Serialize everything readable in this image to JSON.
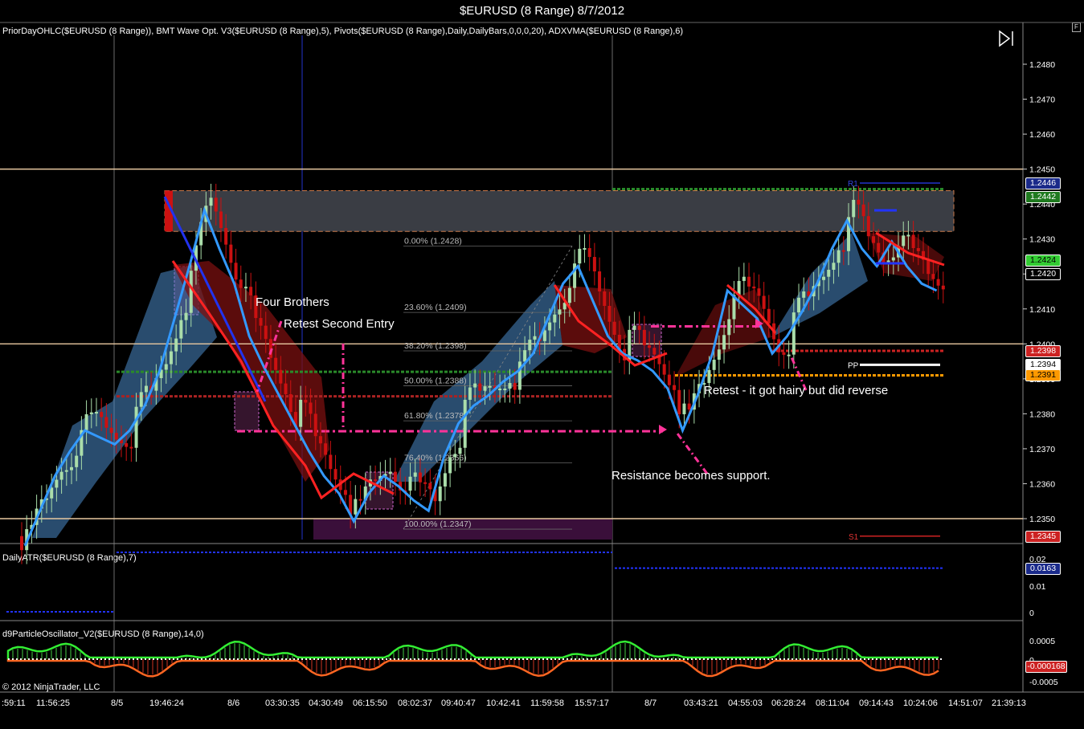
{
  "window": {
    "title": "$EURUSD (8 Range)  8/7/2012",
    "float_button": "F"
  },
  "panels": {
    "price": {
      "indicator_label": "PriorDayOHLC($EURUSD (8 Range)), BMT Wave Opt. V3($EURUSD (8 Range),5), Pivots($EURUSD (8 Range),Daily,DailyBars,0,0,0,20), ADXVMA($EURUSD (8 Range),6)"
    },
    "atr": {
      "indicator_label": "DailyATR($EURUSD (8 Range),7)"
    },
    "oscillator": {
      "indicator_label": "d9ParticleOscillator_V2($EURUSD (8 Range),14,0)"
    }
  },
  "copyright": "© 2012 NinjaTrader, LLC",
  "price_axis": {
    "ticks": [
      "1.2480",
      "1.2470",
      "1.2460",
      "1.2450",
      "1.2440",
      "1.2430",
      "1.2420",
      "1.2410",
      "1.2400",
      "1.2390",
      "1.2380",
      "1.2370",
      "1.2360",
      "1.2350"
    ]
  },
  "price_markers": [
    {
      "label": "1.2446",
      "bg": "#1a2a8a",
      "fg": "#ffffff",
      "value": 1.2446
    },
    {
      "label": "1.2442",
      "bg": "#1f7a1f",
      "fg": "#ffffff",
      "value": 1.2442
    },
    {
      "label": "1.2424",
      "bg": "#33cc33",
      "fg": "#000000",
      "value": 1.2424
    },
    {
      "label": "1.2420",
      "bg": "#000000",
      "fg": "#ffffff",
      "value": 1.242
    },
    {
      "label": "1.2398",
      "bg": "#cc2222",
      "fg": "#ffffff",
      "value": 1.2398
    },
    {
      "label": "1.2394",
      "bg": "#ffffff",
      "fg": "#000000",
      "value": 1.2394
    },
    {
      "label": "1.2391",
      "bg": "#ff9900",
      "fg": "#000000",
      "value": 1.2391
    },
    {
      "label": "1.2345",
      "bg": "#cc2222",
      "fg": "#ffffff",
      "value": 1.2345
    }
  ],
  "pivot_labels": {
    "r1": "R1",
    "pp": "PP",
    "s1": "S1"
  },
  "fib_levels": [
    {
      "label": "0.00% (1.2428)",
      "value": 1.2428
    },
    {
      "label": "23.60% (1.2409)",
      "value": 1.2409
    },
    {
      "label": "38.20% (1.2398)",
      "value": 1.2398
    },
    {
      "label": "50.00% (1.2388)",
      "value": 1.2388
    },
    {
      "label": "61.80% (1.2378)",
      "value": 1.2378
    },
    {
      "label": "76.40% (1.2366)",
      "value": 1.2366
    },
    {
      "label": "100.00% (1.2347)",
      "value": 1.2347
    }
  ],
  "annotations": {
    "four_brothers": "Four Brothers",
    "retest_second": "Retest Second Entry",
    "retest_hairy": "Retest - it got hairy but did reverse",
    "resistance_support": "Resistance becomes support."
  },
  "atr_axis": {
    "ticks": [
      "0.02",
      "0.01",
      "0"
    ],
    "marker": "0.0163"
  },
  "osc_axis": {
    "ticks": [
      "0.0005",
      "0",
      "-0.0005"
    ],
    "marker": "-0.000168"
  },
  "time_axis": {
    "labels": [
      ":59:11",
      "11:56:25",
      "8/5",
      "19:46:24",
      "8/6",
      "03:30:35",
      "04:30:49",
      "06:15:50",
      "08:02:37",
      "09:40:47",
      "10:42:41",
      "11:59:58",
      "15:57:17",
      "8/7",
      "03:43:21",
      "04:55:03",
      "06:28:24",
      "08:11:04",
      "09:14:43",
      "10:24:06",
      "14:51:07",
      "21:39:13"
    ]
  },
  "colors": {
    "level_line": "#e8c8a0",
    "up_candle": "#aaddaa",
    "down_candle": "#cc1111",
    "annotation": "#ff3399"
  },
  "chart_data": {
    "type": "candlestick",
    "title": "$EURUSD (8 Range)  8/7/2012",
    "ylim": [
      1.2344,
      1.2486
    ],
    "horizontal_levels": [
      1.245,
      1.24,
      1.235
    ],
    "fib_retracement": {
      "high": 1.2428,
      "low": 1.2347
    },
    "resistance_zone": [
      1.2434,
      1.2442
    ],
    "pivots": {
      "R1": 1.2446,
      "PP": 1.2394,
      "S1": 1.2345
    },
    "close_path": [
      1.2345,
      1.2355,
      1.2365,
      1.2372,
      1.2378,
      1.2376,
      1.2374,
      1.2378,
      1.2385,
      1.2395,
      1.241,
      1.2425,
      1.2441,
      1.243,
      1.242,
      1.2405,
      1.2396,
      1.2388,
      1.238,
      1.2372,
      1.2365,
      1.236,
      1.2352,
      1.236,
      1.2365,
      1.2362,
      1.2358,
      1.2355,
      1.237,
      1.238,
      1.2385,
      1.2388,
      1.2392,
      1.2395,
      1.24,
      1.241,
      1.242,
      1.2425,
      1.2415,
      1.2405,
      1.24,
      1.2398,
      1.2395,
      1.239,
      1.2378,
      1.2388,
      1.24,
      1.2418,
      1.2414,
      1.241,
      1.24,
      1.2405,
      1.2412,
      1.242,
      1.243,
      1.2438,
      1.243,
      1.2425,
      1.2432,
      1.2425,
      1.242,
      1.2418
    ]
  }
}
